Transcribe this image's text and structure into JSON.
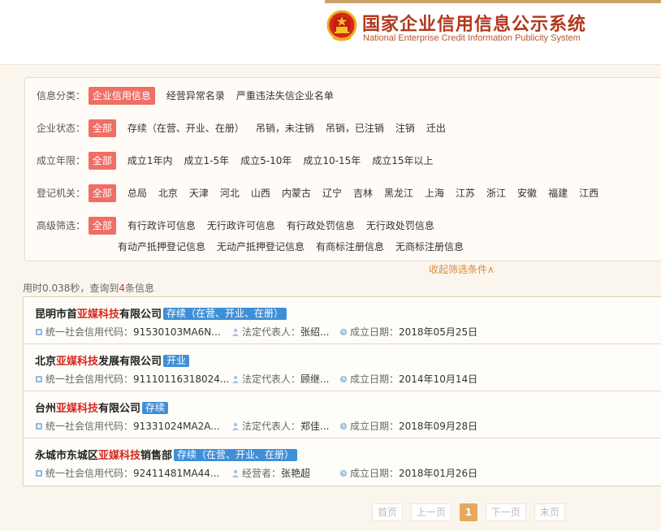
{
  "header": {
    "title_cn": "国家企业信用信息公示系统",
    "title_en": "National Enterprise Credit Information Publicity System"
  },
  "filters": [
    {
      "label": "信息分类：",
      "options": [
        "企业信用信息",
        "经营异常名录",
        "严重违法失信企业名单"
      ],
      "active": 0
    },
    {
      "label": "企业状态：",
      "options": [
        "全部",
        "存续（在营、开业、在册）",
        "吊销，未注销",
        "吊销，已注销",
        "注销",
        "迁出"
      ],
      "active": 0
    },
    {
      "label": "成立年限：",
      "options": [
        "全部",
        "成立1年内",
        "成立1-5年",
        "成立5-10年",
        "成立10-15年",
        "成立15年以上"
      ],
      "active": 0
    },
    {
      "label": "登记机关：",
      "options": [
        "全部",
        "总局",
        "北京",
        "天津",
        "河北",
        "山西",
        "内蒙古",
        "辽宁",
        "吉林",
        "黑龙江",
        "上海",
        "江苏",
        "浙江",
        "安徽",
        "福建",
        "江西"
      ],
      "active": 0
    },
    {
      "label": "高级筛选：",
      "options": [
        "全部",
        "有行政许可信息",
        "无行政许可信息",
        "有行政处罚信息",
        "无行政处罚信息"
      ],
      "active": 0
    },
    {
      "label": "",
      "options": [
        "有动产抵押登记信息",
        "无动产抵押登记信息",
        "有商标注册信息",
        "无商标注册信息"
      ],
      "active": -1
    }
  ],
  "collapse_label": "收起筛选条件∧",
  "stat": {
    "prefix": "用时0.038秒，查询到",
    "count": "4",
    "suffix": "条信息"
  },
  "results": [
    {
      "name_pre": "昆明市首",
      "name_hl": "亚媒科技",
      "name_post": "有限公司",
      "status": "存续（在营、开业、在册）",
      "code_label": "统一社会信用代码：",
      "code": "91530103MA6N...",
      "rep_label": "法定代表人：",
      "rep": "张绍...",
      "date_label": "成立日期：",
      "date": "2018年05月25日"
    },
    {
      "name_pre": "北京",
      "name_hl": "亚媒科技",
      "name_post": "发展有限公司",
      "status": "开业",
      "code_label": "统一社会信用代码：",
      "code": "91110116318024...",
      "rep_label": "法定代表人：",
      "rep": "顾继...",
      "date_label": "成立日期：",
      "date": "2014年10月14日"
    },
    {
      "name_pre": "台州",
      "name_hl": "亚媒科技",
      "name_post": "有限公司",
      "status": "存续",
      "code_label": "统一社会信用代码：",
      "code": "91331024MA2A...",
      "rep_label": "法定代表人：",
      "rep": "郑佳...",
      "date_label": "成立日期：",
      "date": "2018年09月28日"
    },
    {
      "name_pre": "永城市东城区",
      "name_hl": "亚媒科技",
      "name_post": "销售部",
      "status": "存续（在营、开业、在册）",
      "code_label": "统一社会信用代码：",
      "code": "92411481MA44...",
      "rep_label": "经营者：",
      "rep": "张艳超",
      "date_label": "成立日期：",
      "date": "2018年01月26日"
    }
  ],
  "pager": {
    "first": "首页",
    "prev": "上一页",
    "current": "1",
    "next": "下一页",
    "last": "末页"
  },
  "colors": {
    "accent_red": "#ef6e65",
    "badge_blue": "#3f8fd8",
    "highlight_red": "#d4281c",
    "page_current": "#e7a85e"
  }
}
